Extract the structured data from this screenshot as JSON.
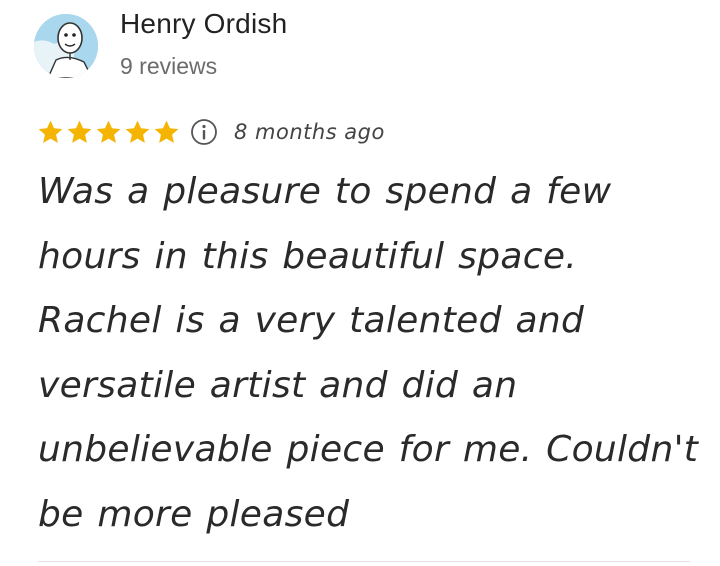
{
  "review": {
    "author_name": "Henry Ordish",
    "review_count": "9 reviews",
    "rating": 5,
    "rating_max": 5,
    "time_ago": "8 months ago",
    "text": "Was a pleasure to spend a few hours in this beautiful space. Rachel is a very talented and versatile artist and did an unbelievable piece for me. Couldn't be more pleased"
  },
  "icons": {
    "avatar": "avatar-cartoon-face",
    "star": "star-icon",
    "info": "info-icon"
  },
  "colors": {
    "star": "#F4B400",
    "name": "#222222",
    "secondary": "#6b6b6b",
    "body_text": "#2a2a2a"
  }
}
